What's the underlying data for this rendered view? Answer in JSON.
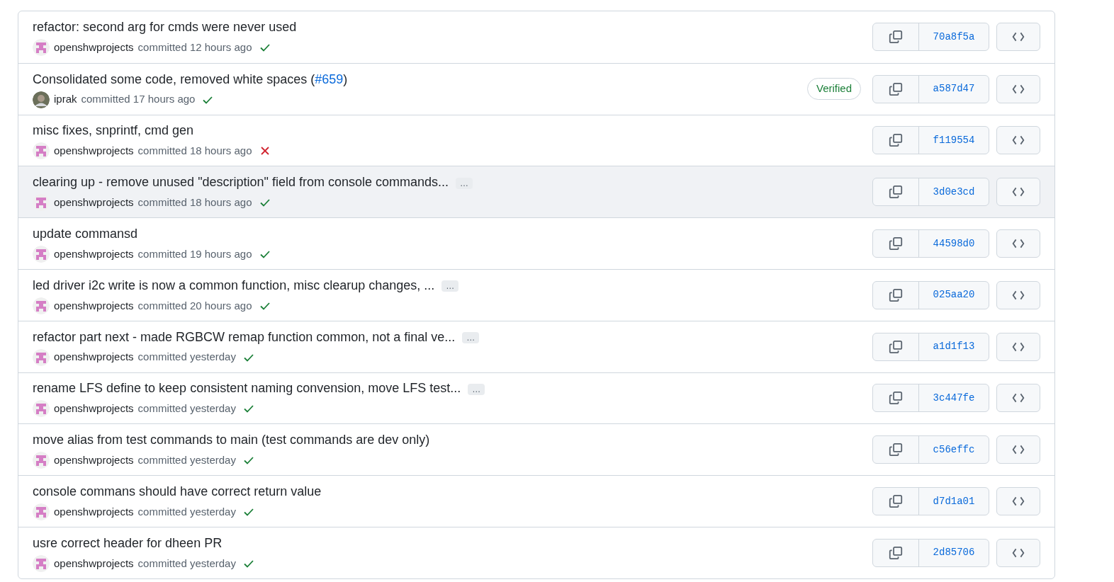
{
  "commits": [
    {
      "title": "refactor: second arg for cmds were never used",
      "author": "openshwprojects",
      "avatar": {
        "kind": "identicon"
      },
      "action": "committed",
      "time": "12 hours ago",
      "status": {
        "kind": "success"
      },
      "sha": "70a8f5a",
      "highlighted": false
    },
    {
      "title": "Consolidated some code, removed white spaces (",
      "link": "#659",
      "title_end": ")",
      "author": "iprak",
      "avatar": {
        "kind": "photo"
      },
      "action": "committed",
      "time": "17 hours ago",
      "status": {
        "kind": "success"
      },
      "badge": "Verified",
      "sha": "a587d47",
      "highlighted": false
    },
    {
      "title": "misc fixes, snprintf, cmd gen",
      "author": "openshwprojects",
      "avatar": {
        "kind": "identicon"
      },
      "action": "committed",
      "time": "18 hours ago",
      "status": {
        "kind": "failure"
      },
      "sha": "f119554",
      "highlighted": false
    },
    {
      "title": "clearing up - remove unused \"description\" field from console commands...",
      "expand": "…",
      "author": "openshwprojects",
      "avatar": {
        "kind": "identicon"
      },
      "action": "committed",
      "time": "18 hours ago",
      "status": {
        "kind": "success"
      },
      "sha": "3d0e3cd",
      "highlighted": true
    },
    {
      "title": "update commansd",
      "author": "openshwprojects",
      "avatar": {
        "kind": "identicon"
      },
      "action": "committed",
      "time": "19 hours ago",
      "status": {
        "kind": "success"
      },
      "sha": "44598d0",
      "highlighted": false
    },
    {
      "title": "led driver i2c write is now a common function, misc clearup changes, ...",
      "expand": "…",
      "author": "openshwprojects",
      "avatar": {
        "kind": "identicon"
      },
      "action": "committed",
      "time": "20 hours ago",
      "status": {
        "kind": "success"
      },
      "sha": "025aa20",
      "highlighted": false
    },
    {
      "title": "refactor part next - made RGBCW remap function common, not a final ve...",
      "expand": "…",
      "author": "openshwprojects",
      "avatar": {
        "kind": "identicon"
      },
      "action": "committed",
      "time": "yesterday",
      "status": {
        "kind": "success"
      },
      "sha": "a1d1f13",
      "highlighted": false
    },
    {
      "title": "rename LFS define to keep consistent naming convension, move LFS test...",
      "expand": "…",
      "author": "openshwprojects",
      "avatar": {
        "kind": "identicon"
      },
      "action": "committed",
      "time": "yesterday",
      "status": {
        "kind": "success"
      },
      "sha": "3c447fe",
      "highlighted": false
    },
    {
      "title": "move alias from test commands to main (test commands are dev only)",
      "author": "openshwprojects",
      "avatar": {
        "kind": "identicon"
      },
      "action": "committed",
      "time": "yesterday",
      "status": {
        "kind": "success"
      },
      "sha": "c56effc",
      "highlighted": false
    },
    {
      "title": "console commans should have correct return value",
      "author": "openshwprojects",
      "avatar": {
        "kind": "identicon"
      },
      "action": "committed",
      "time": "yesterday",
      "status": {
        "kind": "success"
      },
      "sha": "d7d1a01",
      "highlighted": false
    },
    {
      "title": "usre correct header for dheen PR",
      "author": "openshwprojects",
      "avatar": {
        "kind": "identicon"
      },
      "action": "committed",
      "time": "yesterday",
      "status": {
        "kind": "success"
      },
      "sha": "2d85706",
      "highlighted": false
    }
  ]
}
